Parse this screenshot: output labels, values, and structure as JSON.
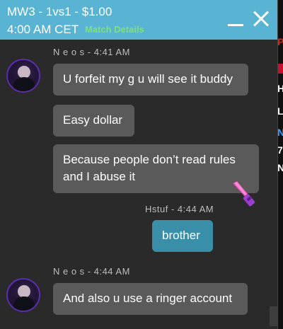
{
  "header": {
    "title": "MW3 - 1vs1 - $1.00",
    "time": "4:00 AM CET",
    "match_details_label": "Match Details"
  },
  "messages": [
    {
      "sender_line": "N e o s - 4:41 AM",
      "text": "U forfeit my g u will see it buddy"
    },
    {
      "text": "Easy dollar"
    },
    {
      "text": "Because people don’t read rules and I abuse it"
    },
    {
      "sender_line": "Hstuf - 4:44 AM",
      "text": "brother",
      "mine": true
    },
    {
      "sender_line": "N e o s - 4:44 AM",
      "text": "And also u use a ringer account"
    }
  ],
  "background_fragments": [
    "P",
    "H",
    "L",
    "N",
    "7",
    "N"
  ],
  "colors": {
    "header": "#59b3d2",
    "match_link": "#7fe07a",
    "bubble_other": "#5a5a5a",
    "bubble_mine": "#3a8fa8",
    "panel": "#2a2a2a"
  },
  "icons": {
    "minimize": "minimize-icon",
    "close": "close-icon",
    "sticker": "knife-sticker-icon"
  }
}
